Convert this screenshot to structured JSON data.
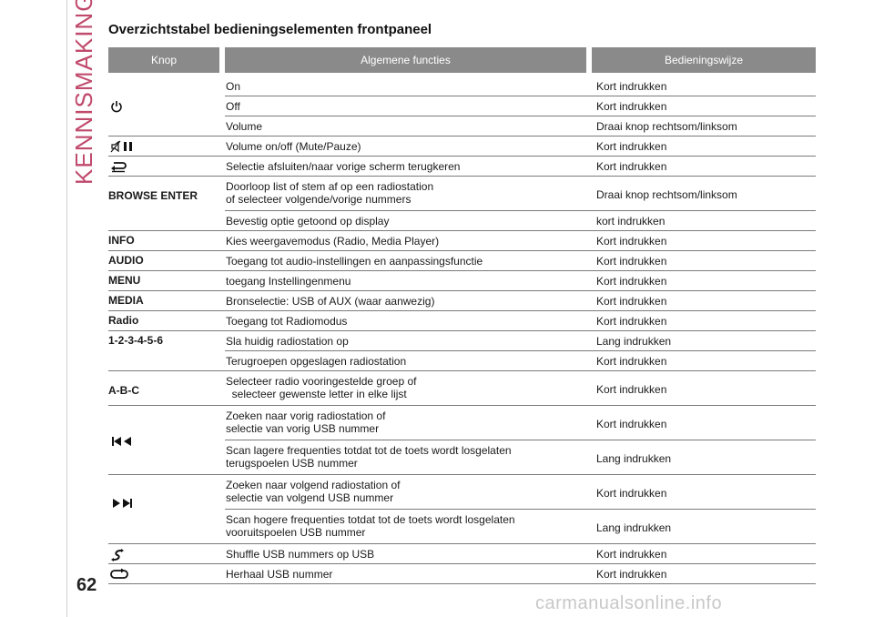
{
  "page": {
    "side_title": "KENNISMAKING MET DE AUTO",
    "page_number": "62",
    "watermark": "carmanualsonline.info"
  },
  "heading": "Overzichtstabel bedieningselementen frontpaneel",
  "table": {
    "headers": [
      "Knop",
      "Algemene functies",
      "Bedieningswijze"
    ],
    "rows": [
      {
        "knop": "",
        "icon": "power-icon",
        "func": "On",
        "op": "Kort indrukken"
      },
      {
        "knop": "",
        "icon": "",
        "func": "Off",
        "op": "Kort indrukken"
      },
      {
        "knop": "",
        "icon": "",
        "func": "Volume",
        "op": "Draai knop rechtsom/linksom"
      },
      {
        "knop": "",
        "icon": "mute-pause-icon",
        "func": "Volume on/off (Mute/Pauze)",
        "op": "Kort indrukken"
      },
      {
        "knop": "",
        "icon": "back-icon",
        "func": "Selectie afsluiten/naar vorige scherm terugkeren",
        "op": "Kort indrukken"
      },
      {
        "knop": "BROWSE ENTER",
        "icon": "",
        "func": "Doorloop list of stem af op een radiostation\nof selecteer volgende/vorige nummers",
        "op": "Draai knop rechtsom/linksom"
      },
      {
        "knop": "",
        "icon": "",
        "func": "Bevestig optie getoond op display",
        "op": "kort indrukken"
      },
      {
        "knop": "INFO",
        "icon": "",
        "func": "Kies weergavemodus (Radio, Media Player)",
        "op": "Kort indrukken"
      },
      {
        "knop": "AUDIO",
        "icon": "",
        "func": "Toegang tot audio-instellingen en aanpassingsfunctie",
        "op": "Kort indrukken"
      },
      {
        "knop": "MENU",
        "icon": "",
        "func": "toegang Instellingenmenu",
        "op": "Kort indrukken"
      },
      {
        "knop": "MEDIA",
        "icon": "",
        "func": "Bronselectie: USB of AUX (waar aanwezig)",
        "op": "Kort indrukken"
      },
      {
        "knop": "Radio",
        "icon": "",
        "func": "Toegang tot Radiomodus",
        "op": "Kort indrukken"
      },
      {
        "knop": "1-2-3-4-5-6",
        "icon": "",
        "func": "Sla huidig radiostation op",
        "op": "Lang indrukken"
      },
      {
        "knop": "",
        "icon": "",
        "func": "Terugroepen opgeslagen radiostation",
        "op": "Kort indrukken"
      },
      {
        "knop": "A-B-C",
        "icon": "",
        "func": "Selecteer radio vooringestelde groep of\n  selecteer gewenste letter in elke lijst",
        "op": "Kort indrukken"
      },
      {
        "knop": "",
        "icon": "previous-icon",
        "func": "Zoeken naar vorig radiostation of\nselectie van vorig USB nummer",
        "op": "Kort indrukken"
      },
      {
        "knop": "",
        "icon": "",
        "func": "Scan lagere frequenties totdat tot de toets wordt losgelaten\nterugspoelen USB nummer",
        "op": "Lang indrukken"
      },
      {
        "knop": "",
        "icon": "next-icon",
        "func": "Zoeken naar volgend radiostation of\nselectie van volgend USB nummer",
        "op": "Kort indrukken"
      },
      {
        "knop": "",
        "icon": "",
        "func": "Scan hogere frequenties totdat tot de toets wordt losgelaten\nvooruitspoelen USB nummer",
        "op": "Lang indrukken"
      },
      {
        "knop": "",
        "icon": "shuffle-icon",
        "func": "Shuffle USB nummers op USB",
        "op": "Kort indrukken"
      },
      {
        "knop": "",
        "icon": "repeat-icon",
        "func": "Herhaal USB nummer",
        "op": "Kort indrukken"
      }
    ]
  }
}
